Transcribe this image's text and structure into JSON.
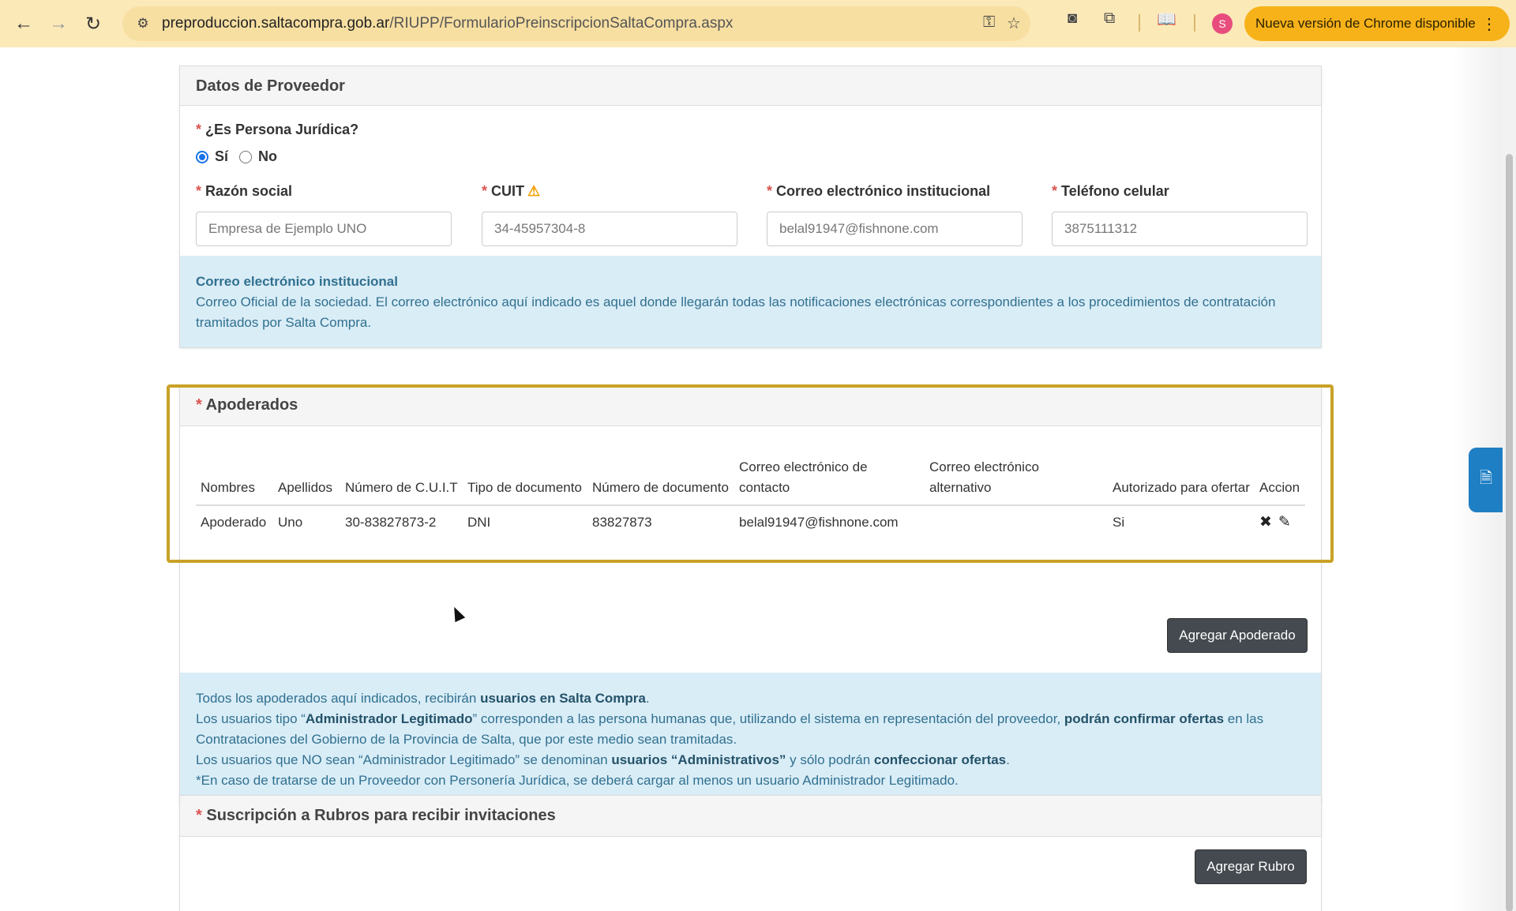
{
  "browser": {
    "url_host": "preproduccion.saltacompra.gob.ar",
    "url_path": "/RIUPP/FormularioPreinscripcionSaltaCompra.aspx",
    "update_label": "Nueva versión de Chrome disponible",
    "profile_initial": "S"
  },
  "proveedor": {
    "title": "Datos de Proveedor",
    "persona_juridica_label": "¿Es Persona Jurídica?",
    "radio_si": "Sí",
    "radio_no": "No",
    "fields": {
      "razon_social": {
        "label": "Razón social",
        "value": "Empresa de Ejemplo UNO"
      },
      "cuit": {
        "label": "CUIT",
        "value": "34-45957304-8"
      },
      "correo": {
        "label": "Correo electrónico institucional",
        "value": "belal91947@fishnone.com"
      },
      "telefono": {
        "label": "Teléfono celular",
        "value": "3875111312"
      }
    },
    "info_title": "Correo electrónico institucional",
    "info_text": "Correo Oficial de la sociedad. El correo electrónico aquí indicado es aquel donde llegarán todas las notificaciones electrónicas correspondientes a los procedimientos de contratación tramitados por Salta Compra."
  },
  "apoderados": {
    "title": "Apoderados",
    "columns": [
      "Nombres",
      "Apellidos",
      "Número de C.U.I.T",
      "Tipo de documento",
      "Número de documento",
      "Correo electrónico de contacto",
      "Correo electrónico alternativo",
      "Autorizado para ofertar",
      "Accion"
    ],
    "rows": [
      [
        "Apoderado",
        "Uno",
        "30-83827873-2",
        "DNI",
        "83827873",
        "belal91947@fishnone.com",
        "",
        "Si"
      ]
    ],
    "add_button": "Agregar Apoderado",
    "info": {
      "l1_a": "Todos los apoderados aquí indicados, recibirán ",
      "l1_b": "usuarios en Salta Compra",
      "l1_c": ".",
      "l2_a": "Los usuarios tipo “",
      "l2_b": "Administrador Legitimado",
      "l2_c": "” corresponden a las persona humanas que, utilizando el sistema en representación del proveedor, ",
      "l2_d": "podrán confirmar ofertas",
      "l2_e": " en las Contrataciones del Gobierno de la Provincia de Salta, que por este medio sean tramitadas.",
      "l3_a": "Los usuarios que NO sean “Administrador Legitimado” se denominan ",
      "l3_b": "usuarios “Administrativos”",
      "l3_c": " y sólo podrán ",
      "l3_d": "confeccionar ofertas",
      "l3_e": ".",
      "l4": "*En caso de tratarse de un Proveedor con Personería Jurídica, se deberá cargar al menos un usuario Administrador Legitimado."
    }
  },
  "rubros": {
    "title": "Suscripción a Rubros para recibir invitaciones",
    "add_button": "Agregar Rubro"
  },
  "colors": {
    "highlight": "#c9a227",
    "info_bg": "#d9edf7",
    "required": "#d9534f"
  }
}
